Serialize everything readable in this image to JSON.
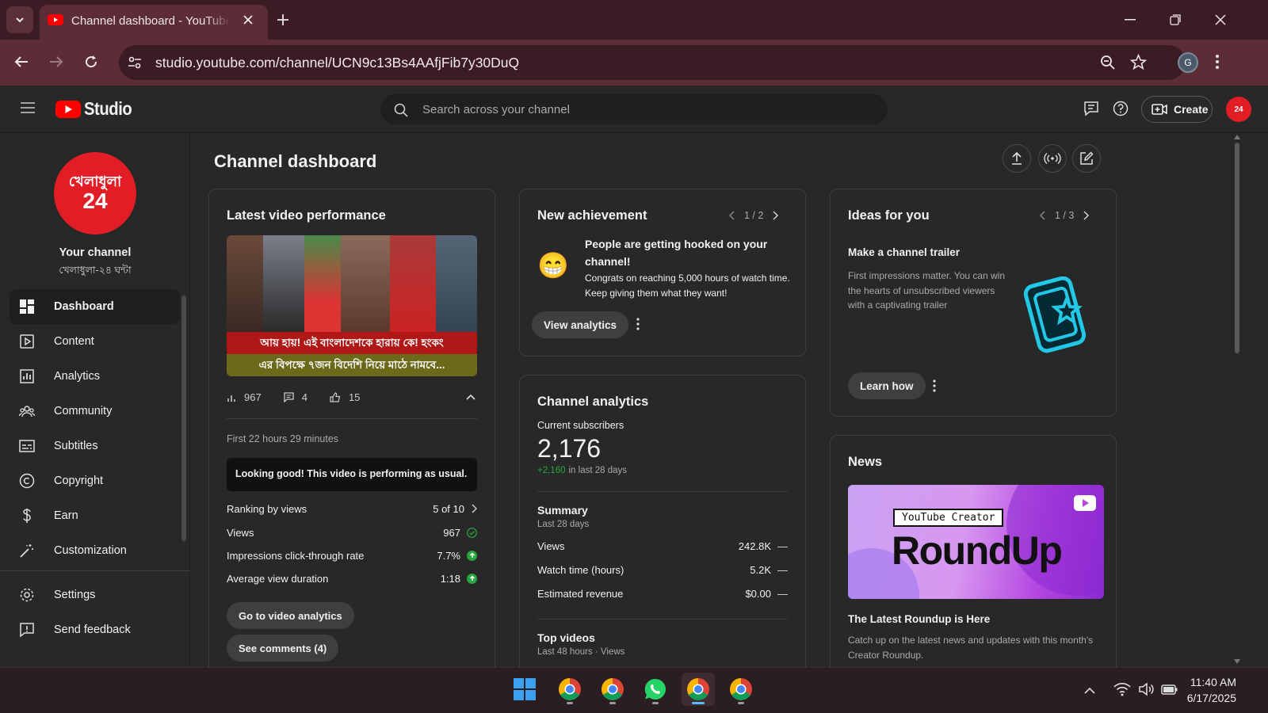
{
  "browser": {
    "tab_title": "Channel dashboard - YouTube Studio",
    "url": "studio.youtube.com/channel/UCN9c13Bs4AAfjFib7y30DuQ",
    "profile_initial": "G"
  },
  "header": {
    "logo_text": "Studio",
    "search_placeholder": "Search across your channel",
    "create_label": "Create"
  },
  "sidebar": {
    "avatar_text_top": "খেলাধুলা",
    "avatar_text_num": "24",
    "your_channel": "Your channel",
    "channel_name": "খেলাধুলা-২৪ ঘন্টা",
    "items": [
      {
        "label": "Dashboard",
        "icon": "dashboard-icon"
      },
      {
        "label": "Content",
        "icon": "content-icon"
      },
      {
        "label": "Analytics",
        "icon": "analytics-icon"
      },
      {
        "label": "Community",
        "icon": "community-icon"
      },
      {
        "label": "Subtitles",
        "icon": "subtitles-icon"
      },
      {
        "label": "Copyright",
        "icon": "copyright-icon"
      },
      {
        "label": "Earn",
        "icon": "earn-icon"
      },
      {
        "label": "Customization",
        "icon": "customization-icon"
      }
    ],
    "settings": "Settings",
    "feedback": "Send feedback"
  },
  "main": {
    "title": "Channel dashboard"
  },
  "latest_video": {
    "title": "Latest video performance",
    "thumb_caption_1": "আয় হায়! এই বাংলাদেশকে হারায় কে! হংকং",
    "thumb_caption_2": "এর বিপক্ষে ৭জন বিদেশি নিয়ে মাঠে নামবে...",
    "views_stat": "967",
    "comments_stat": "4",
    "likes_stat": "15",
    "period": "First 22 hours 29 minutes",
    "status": "Looking good! This video is performing as usual.",
    "rows": [
      {
        "label": "Ranking by views",
        "value": "5 of 10"
      },
      {
        "label": "Views",
        "value": "967"
      },
      {
        "label": "Impressions click-through rate",
        "value": "7.7%"
      },
      {
        "label": "Average view duration",
        "value": "1:18"
      }
    ],
    "go_analytics": "Go to video analytics",
    "see_comments": "See comments (4)"
  },
  "achievement": {
    "title": "New achievement",
    "pager": "1 / 2",
    "emoji": "😁",
    "headline": "People are getting hooked on your channel!",
    "body": "Congrats on reaching 5,000 hours of watch time. Keep giving them what they want!",
    "button": "View analytics"
  },
  "channel_analytics": {
    "title": "Channel analytics",
    "subs_label": "Current subscribers",
    "subs_value": "2,176",
    "subs_delta": "+2,160",
    "subs_delta_suffix": "in last 28 days",
    "summary_title": "Summary",
    "summary_period": "Last 28 days",
    "rows": [
      {
        "label": "Views",
        "value": "242.8K"
      },
      {
        "label": "Watch time (hours)",
        "value": "5.2K"
      },
      {
        "label": "Estimated revenue",
        "value": "$0.00"
      }
    ],
    "top_videos": "Top videos",
    "top_videos_sub": "Last 48 hours · Views"
  },
  "ideas": {
    "title": "Ideas for you",
    "pager": "1 / 3",
    "idea_title": "Make a channel trailer",
    "idea_body": "First impressions matter. You can win the hearts of unsubscribed viewers with a captivating trailer",
    "button": "Learn how"
  },
  "news": {
    "title": "News",
    "banner_tag": "YouTube Creator",
    "banner_title": "RoundUp",
    "headline": "The Latest Roundup is Here",
    "body": "Catch up on the latest news and updates with this month's Creator Roundup."
  },
  "taskbar": {
    "time": "11:40 AM",
    "date": "6/17/2025"
  },
  "colors": {
    "accent_red": "#ff0000",
    "positive_green": "#2ba640",
    "chrome_dark": "#3b1c24",
    "chrome_mid": "#5c2d37"
  }
}
